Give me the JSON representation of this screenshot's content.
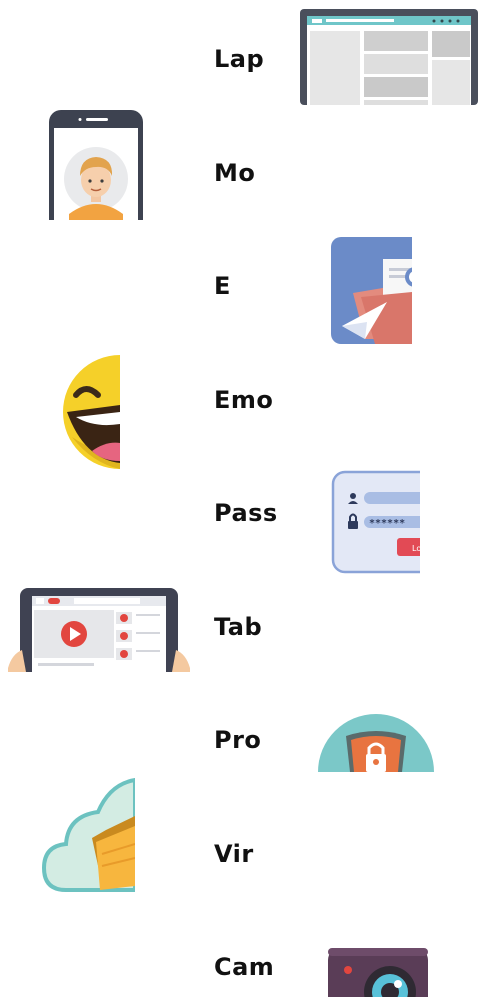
{
  "labels": [
    "Lap",
    "Mo",
    "E",
    "Emo",
    "Pass",
    "Tab",
    "Pro",
    "Vir",
    "Cam"
  ],
  "password_mask": "******",
  "login_text": "Lo",
  "colors": {
    "text": "#111111",
    "laptop_frame": "#4a4f5c",
    "laptop_accent": "#6fc6c9",
    "phone_frame": "#3d4250",
    "email_bg": "#6b8bc8",
    "email_envelope": "#e38b7e",
    "emoji_yellow": "#f5d029",
    "pass_bg": "#e3e8f6",
    "pass_button": "#e24a55",
    "tablet_frame": "#3f4252",
    "play_red": "#e2463f",
    "shield_teal": "#7bc8c8",
    "shield_orange": "#e87440",
    "cloud_fill": "#d3ece3",
    "cloud_stroke": "#6cc2c0",
    "folder_yellow": "#f7b63e",
    "camera_body": "#5a3d57",
    "camera_lens": "#58c1d8"
  },
  "icons": [
    "laptop-icon",
    "mobile-icon",
    "email-icon",
    "emoji-icon",
    "password-icon",
    "tablet-icon",
    "protection-icon",
    "virtual-cloud-icon",
    "camera-icon"
  ]
}
